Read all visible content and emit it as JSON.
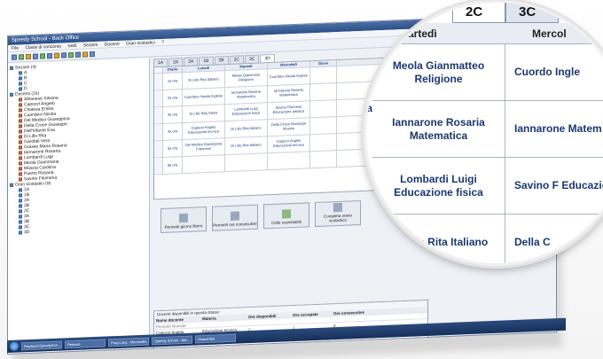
{
  "app": {
    "title": "Speedy School - Back Office",
    "menu": [
      "File",
      "Classi di concorso",
      "Sedi",
      "Sezioni",
      "Docenti",
      "Orari scolastici",
      "?"
    ]
  },
  "sidebar": {
    "groups": [
      {
        "label": "Sezioni (4)",
        "items": [
          "A",
          "B",
          "C",
          "D"
        ]
      },
      {
        "label": "Docenti (16)",
        "items": [
          "Albanese Silvana",
          "Capozzi Angelo",
          "Chiaesa Emilio",
          "Cuordoro Nicola",
          "Del Medico Giuseppina",
          "Della Croce Giuseppe",
          "Dell'Infante Eva",
          "Di Lillo Rita",
          "Garofali Vera",
          "Grasso Maria Rosaria",
          "Iannarone Rosaria",
          "Lombardi Luigi",
          "Meola Giammaria",
          "Moscia Carolina",
          "Puerto Rosaria",
          "Savino Filomena"
        ]
      },
      {
        "label": "Orari scolastici (9)",
        "items": [
          "1A",
          "1B",
          "2A",
          "2B",
          "2C",
          "3A",
          "3B",
          "3C",
          "3D"
        ]
      }
    ]
  },
  "main": {
    "tabs": [
      "1A",
      "2A",
      "3A",
      "1B",
      "2B",
      "2C",
      "3C",
      "3D"
    ],
    "grid": {
      "headers": [
        "Orario",
        "Lunedì",
        "Martedì",
        "Mercoledì",
        "Giove"
      ],
      "rows": [
        {
          "time": "1a ora",
          "cells": [
            "Di Lillo Rita Italiano",
            "Meola Giammaria Religione",
            "Cuordoro Nicola Inglese"
          ]
        },
        {
          "time": "2a ora",
          "cells": [
            "Cuordoro Nicola Inglese",
            "Iannarone Rosaria Matematica",
            "Iannarone Rosaria Matematica"
          ]
        },
        {
          "time": "3a ora",
          "cells": [
            "Di Lillo Rita Storia",
            "Lombardi Luigi Educazione fisica",
            "Savino Filomena Educazione artistica"
          ]
        },
        {
          "time": "4a ora",
          "cells": [
            "Capozzi Angelo Educazione tecnica",
            "Di Lillo Rita Italiano",
            "Della Croce Giuseppe Musica"
          ]
        },
        {
          "time": "5a ora",
          "cells": [
            "Del Medico Giuseppina Francese",
            "Di Lillo Rita Italiano",
            "Capozzi Angelo Educazione tecnica"
          ]
        },
        {
          "time": "6a ora",
          "cells": [
            "",
            "",
            ""
          ]
        }
      ]
    },
    "buttons": [
      "Permetti giorno libero",
      "Permetti ore consecutive",
      "Celle scambiabili",
      "Completa orario scolastico"
    ],
    "panel": {
      "title": "Docenti disponibili in questa classe:",
      "headers": [
        "Nome docente",
        "Materia",
        "Ore disponibili",
        "Ore occupate",
        "Ore consecutive"
      ],
      "section": "Persone Normali",
      "rows": [
        {
          "name": "Capozzi Angelo",
          "subject": "Educazione tecnica",
          "avail": "2",
          "busy": "2",
          "consec": "0"
        },
        {
          "name": "Cuordoro Nicola",
          "subject": "Inglese",
          "avail": "3",
          "busy": "3",
          "consec": "0"
        },
        {
          "name": "Del Medico Giuse...",
          "subject": "Francese",
          "avail": "2",
          "busy": "2",
          "consec": "0"
        }
      ]
    }
  },
  "taskbar": {
    "tasks": [
      "Playback/SpeedySch...",
      "Release",
      "Prog.Lang - Microsofts...",
      "Speedy School - Bac...",
      "PhotoFiltre"
    ]
  },
  "lens": {
    "tabs": [
      "2C",
      "3C"
    ],
    "header_left": "Martedì",
    "header_right": "Mercol",
    "left_fragment": "la",
    "col_a": [
      "Meola Gianmatteo Religione",
      "Iannarone Rosaria Matematica",
      "Lombardi Luigi Educazione fisica",
      "Di Lillo Rita Italiano"
    ],
    "col_b": [
      "Cuordo Ingle",
      "Iannarone Matem",
      "Savino F Educazio",
      "Della C"
    ]
  }
}
